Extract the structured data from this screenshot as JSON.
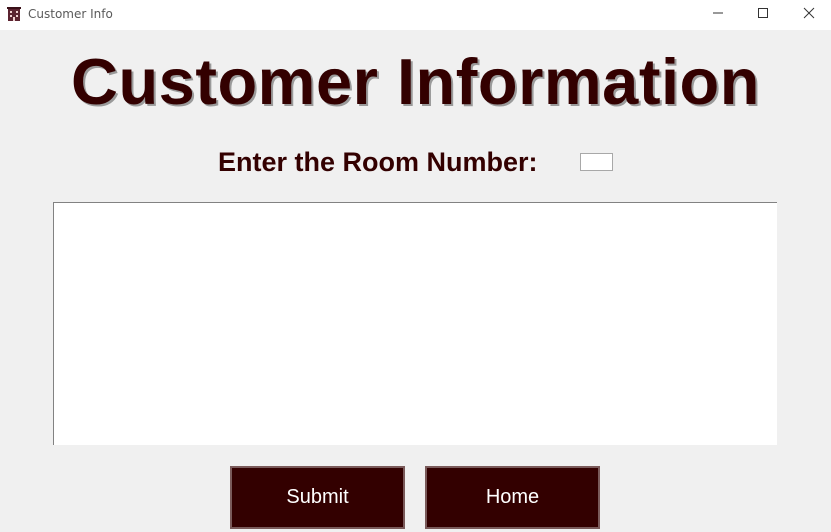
{
  "window": {
    "title": "Customer Info",
    "icon": "hotel-icon",
    "controls": [
      "minimize-icon",
      "maximize-icon",
      "close-icon"
    ]
  },
  "main": {
    "heading": "Customer Information",
    "room_label": "Enter the Room Number:",
    "room_input_value": "",
    "output_text": ""
  },
  "buttons": {
    "submit_label": "Submit",
    "home_label": "Home"
  },
  "colors": {
    "brand": "#330000",
    "background": "#f0f0f0",
    "button_text": "#ffffff"
  }
}
